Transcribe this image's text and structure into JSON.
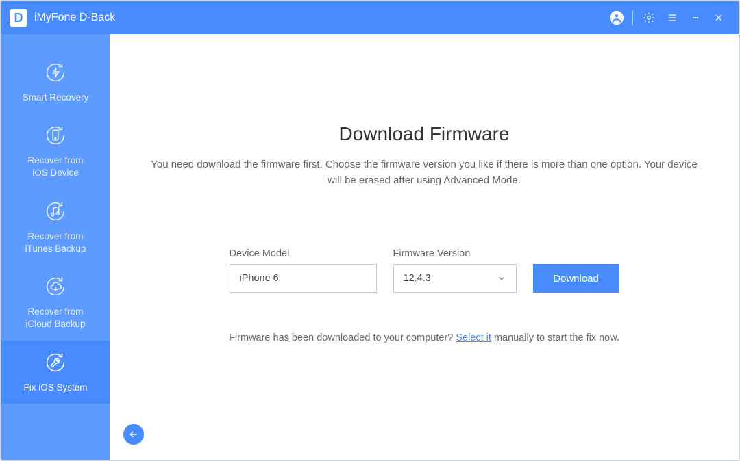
{
  "app": {
    "title": "iMyFone D-Back",
    "logo_letter": "D"
  },
  "sidebar": {
    "items": [
      {
        "label": "Smart Recovery"
      },
      {
        "label": "Recover from\niOS Device"
      },
      {
        "label": "Recover from\niTunes Backup"
      },
      {
        "label": "Recover from\niCloud Backup"
      },
      {
        "label": "Fix iOS System"
      }
    ],
    "active_index": 4
  },
  "main": {
    "heading": "Download Firmware",
    "subtext": "You need download the firmware first. Choose the firmware version you like if there is more than one option. Your device will be erased after using Advanced Mode.",
    "device_model_label": "Device Model",
    "device_model_value": "iPhone 6",
    "firmware_version_label": "Firmware Version",
    "firmware_version_value": "12.4.3",
    "download_button": "Download",
    "helper_prefix": "Firmware has been downloaded to your computer? ",
    "helper_link": "Select it",
    "helper_suffix": " manually to start the fix now."
  }
}
